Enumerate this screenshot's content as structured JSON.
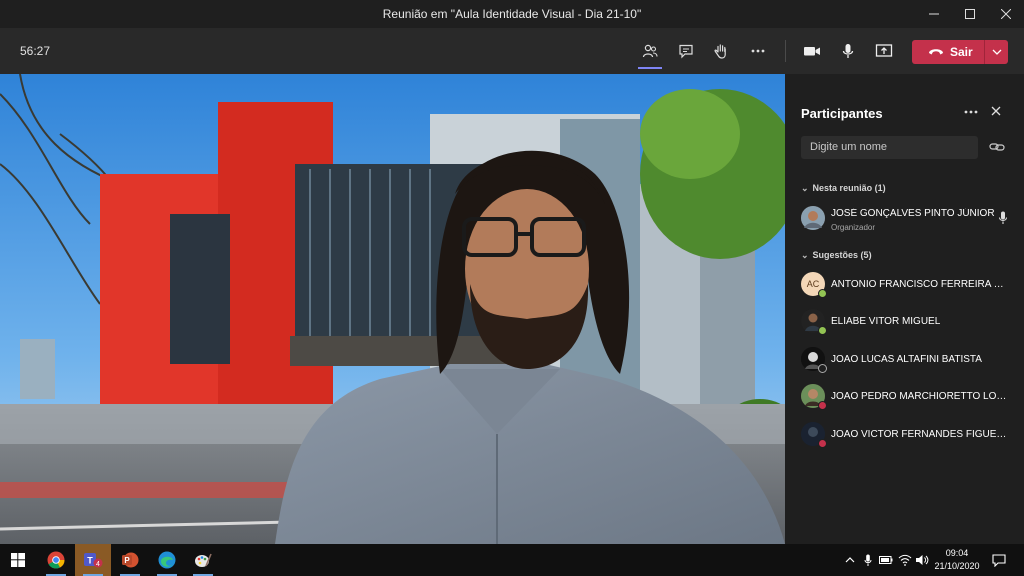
{
  "window": {
    "title": "Reunião em \"Aula Identidade Visual - Dia 21-10\""
  },
  "meeting": {
    "timer": "56:27",
    "leave_label": "Sair"
  },
  "panel": {
    "title": "Participantes",
    "search_placeholder": "Digite um nome",
    "in_meeting_label": "Nesta reunião (1)",
    "suggestions_label": "Sugestões (5)",
    "in_meeting": [
      {
        "name": "JOSÉ GONÇALVES PINTO JÚNIOR",
        "role": "Organizador"
      }
    ],
    "suggestions": [
      {
        "initials": "AC",
        "name": "ANTONIO FRANCISCO FERREIRA CA...",
        "presence": "available"
      },
      {
        "initials": "",
        "name": "ELIABE VITOR MIGUEL",
        "presence": "available"
      },
      {
        "initials": "",
        "name": "JOAO LUCAS ALTAFINI BATISTA",
        "presence": "offline"
      },
      {
        "initials": "",
        "name": "JOAO PEDRO MARCHIORETTO LOPES",
        "presence": "busy"
      },
      {
        "initials": "",
        "name": "JOAO VICTOR FERNANDES FIGUEIRE...",
        "presence": "busy"
      }
    ]
  },
  "taskbar": {
    "time": "09:04",
    "date": "21/10/2020",
    "teams_badge": "4"
  },
  "colors": {
    "accent": "#7f85f5",
    "leave": "#c4314b",
    "available": "#92c353",
    "busy": "#c4314b"
  }
}
